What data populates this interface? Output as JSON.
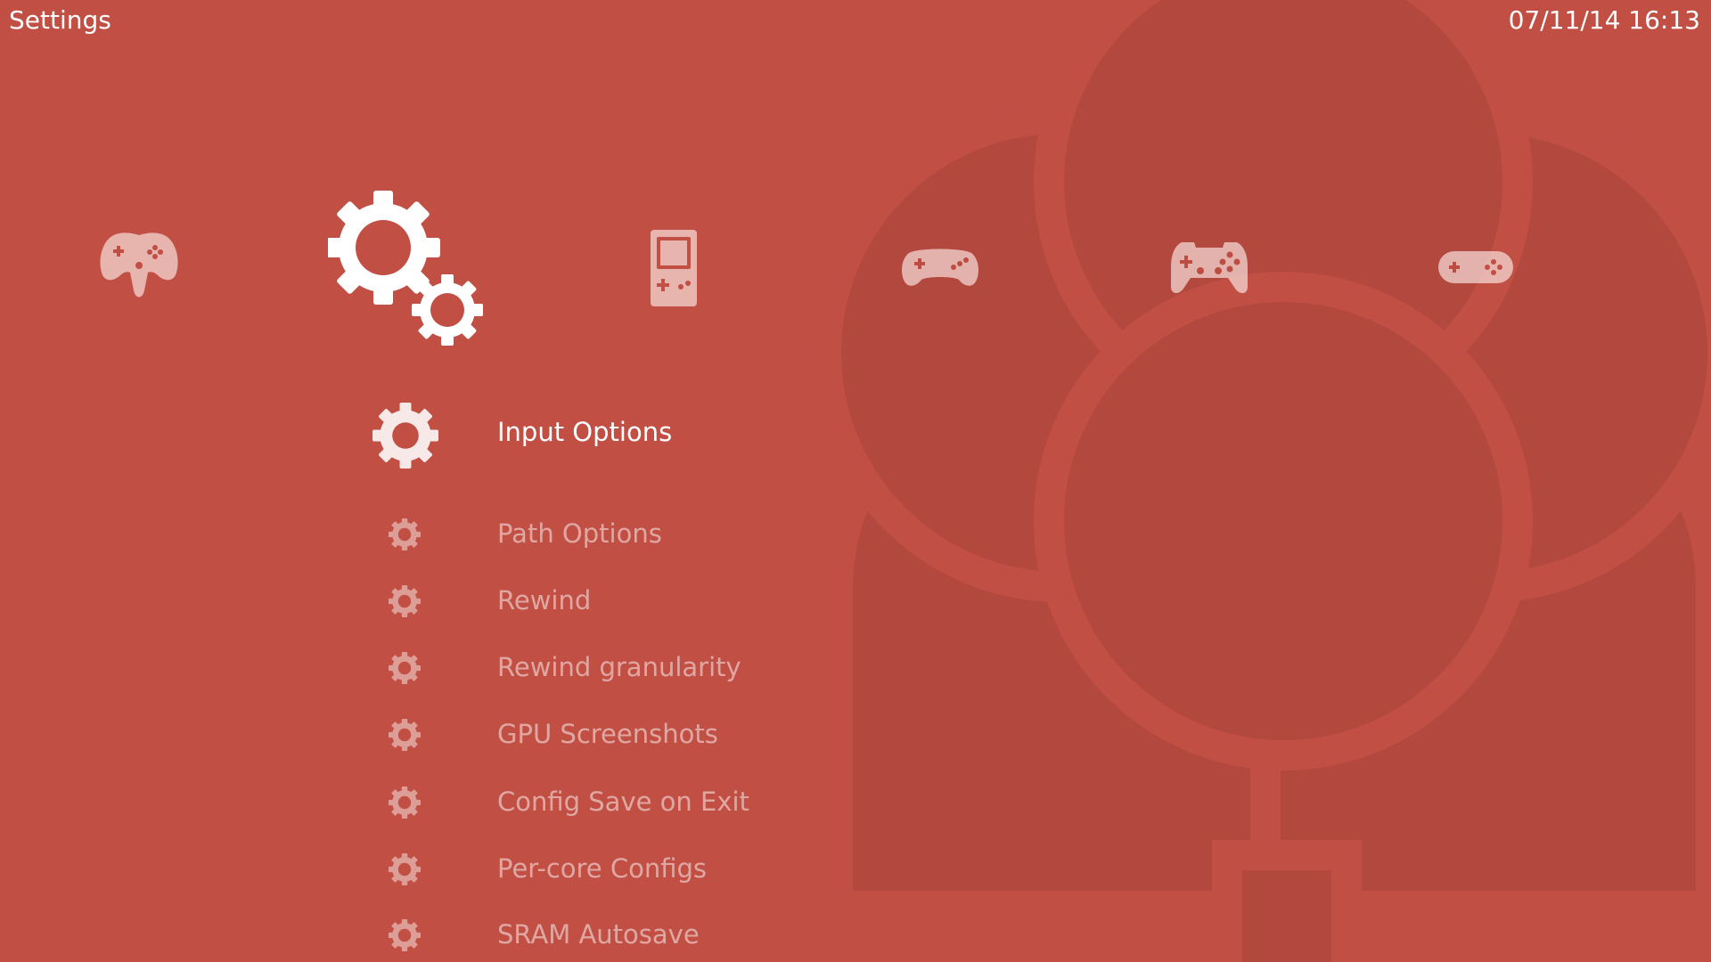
{
  "header": {
    "title": "Settings",
    "clock": "07/11/14 16:13"
  },
  "colors": {
    "background": "#c14f44",
    "logo_fill": "#b3483f",
    "text_active": "#ffffff",
    "text_inactive": "rgba(255,255,255,0.5)"
  },
  "categories": [
    {
      "icon": "n64-controller-icon",
      "active": false
    },
    {
      "icon": "settings-gears-icon",
      "active": true
    },
    {
      "icon": "gameboy-icon",
      "active": false
    },
    {
      "icon": "genesis-controller-icon",
      "active": false
    },
    {
      "icon": "psx-controller-icon",
      "active": false
    },
    {
      "icon": "snes-controller-icon",
      "active": false
    }
  ],
  "menu": {
    "selected_index": 0,
    "items": [
      {
        "label": "Input Options",
        "icon": "gear-icon"
      },
      {
        "label": "Path Options",
        "icon": "gear-icon"
      },
      {
        "label": "Rewind",
        "icon": "gear-icon"
      },
      {
        "label": "Rewind granularity",
        "icon": "gear-icon"
      },
      {
        "label": "GPU Screenshots",
        "icon": "gear-icon"
      },
      {
        "label": "Config Save on Exit",
        "icon": "gear-icon"
      },
      {
        "label": "Per-core Configs",
        "icon": "gear-icon"
      },
      {
        "label": "SRAM Autosave",
        "icon": "gear-icon"
      }
    ]
  }
}
